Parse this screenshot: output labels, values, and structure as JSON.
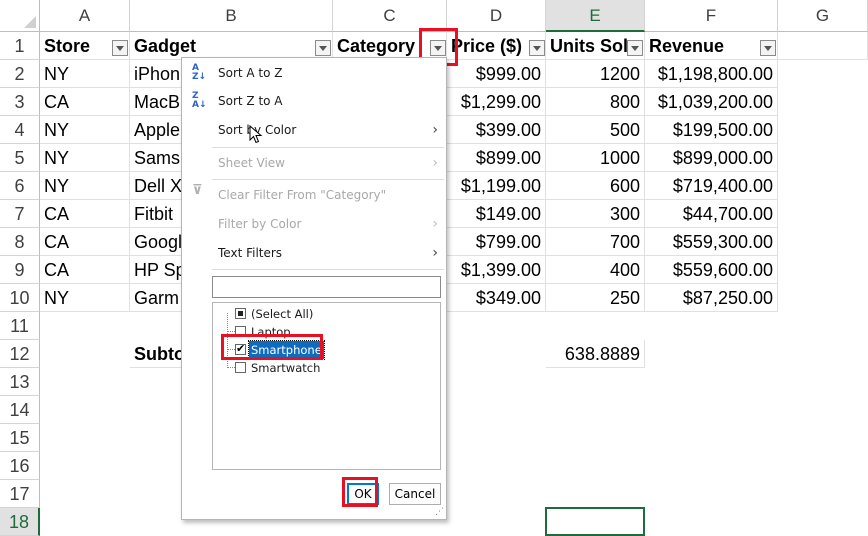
{
  "sheet": {
    "columns": [
      "A",
      "B",
      "C",
      "D",
      "E",
      "F",
      "G"
    ],
    "selected_column": "E",
    "rows": [
      "1",
      "2",
      "3",
      "4",
      "5",
      "6",
      "7",
      "8",
      "9",
      "10",
      "11",
      "12",
      "13",
      "14",
      "15",
      "16",
      "17",
      "18"
    ],
    "selected_row": "18",
    "headers": {
      "store": "Store",
      "gadget": "Gadget",
      "category": "Category",
      "price": "Price ($)",
      "units": "Units Sol",
      "revenue": "Revenue"
    },
    "data": [
      {
        "store": "NY",
        "gadget": "iPhon",
        "price": "$999.00",
        "units": "1200",
        "revenue": "$1,198,800.00"
      },
      {
        "store": "CA",
        "gadget": "MacB",
        "price": "$1,299.00",
        "units": "800",
        "revenue": "$1,039,200.00"
      },
      {
        "store": "NY",
        "gadget": "Apple",
        "price": "$399.00",
        "units": "500",
        "revenue": "$199,500.00"
      },
      {
        "store": "NY",
        "gadget": "Sams",
        "price": "$899.00",
        "units": "1000",
        "revenue": "$899,000.00"
      },
      {
        "store": "NY",
        "gadget": "Dell X",
        "price": "$1,199.00",
        "units": "600",
        "revenue": "$719,400.00"
      },
      {
        "store": "CA",
        "gadget": "Fitbit",
        "price": "$149.00",
        "units": "300",
        "revenue": "$44,700.00"
      },
      {
        "store": "CA",
        "gadget": "Googl",
        "price": "$799.00",
        "units": "700",
        "revenue": "$559,300.00"
      },
      {
        "store": "CA",
        "gadget": "HP Sp",
        "price": "$1,399.00",
        "units": "400",
        "revenue": "$559,600.00"
      },
      {
        "store": "NY",
        "gadget": "Garm",
        "price": "$349.00",
        "units": "250",
        "revenue": "$87,250.00"
      }
    ],
    "subtotal_label": "Subto",
    "subtotal_value": "638.8889"
  },
  "filter_menu": {
    "sort_a_z": "Sort A to Z",
    "sort_z_a": "Sort Z to A",
    "sort_by_color": "Sort by Color",
    "sheet_view": "Sheet View",
    "clear_filter": "Clear Filter From \"Category\"",
    "filter_by_color": "Filter by Color",
    "text_filters": "Text Filters",
    "search_value": "",
    "items": [
      {
        "label": "(Select All)",
        "state": "indeterminate"
      },
      {
        "label": "Laptop",
        "state": "unchecked"
      },
      {
        "label": "Smartphone",
        "state": "checked"
      },
      {
        "label": "Smartwatch",
        "state": "unchecked"
      }
    ],
    "ok_label": "OK",
    "cancel_label": "Cancel"
  },
  "colors": {
    "accent_green": "#1e6b3c",
    "highlight_red": "#e81123",
    "selection_blue": "#0f6cbd"
  }
}
